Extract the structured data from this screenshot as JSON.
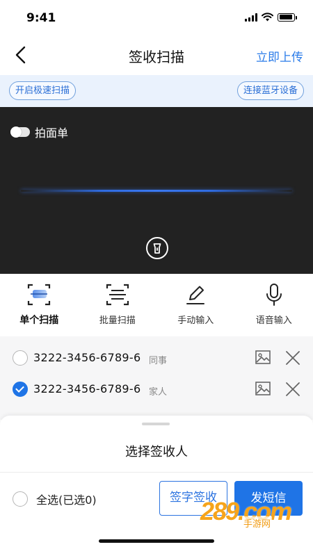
{
  "status": {
    "time": "9:41"
  },
  "nav": {
    "title": "签收扫描",
    "action": "立即上传"
  },
  "toolbar": {
    "fast_scan": "开启极速扫描",
    "bluetooth": "连接蓝牙设备"
  },
  "camera": {
    "toggle_label": "拍面单",
    "toggle_on": false
  },
  "modes": [
    {
      "label": "单个扫描",
      "icon": "single-scan-icon",
      "active": true
    },
    {
      "label": "批量扫描",
      "icon": "batch-scan-icon",
      "active": false
    },
    {
      "label": "手动输入",
      "icon": "pen-icon",
      "active": false
    },
    {
      "label": "语音输入",
      "icon": "microphone-icon",
      "active": false
    }
  ],
  "items": [
    {
      "code": "3222-3456-6789-6",
      "tag": "同事",
      "checked": false
    },
    {
      "code": "3222-3456-6789-6",
      "tag": "家人",
      "checked": true
    }
  ],
  "sheet": {
    "title": "选择签收人",
    "select_all": "全选(已选0)",
    "sign_button": "签字签收",
    "sms_button": "发短信"
  },
  "watermark": {
    "main": "289.com",
    "sub": "手游网"
  },
  "colors": {
    "accent": "#1f74e6",
    "camera_bg": "#222222",
    "strip_bg": "#eaf2fd",
    "watermark": "#f6a41b"
  }
}
